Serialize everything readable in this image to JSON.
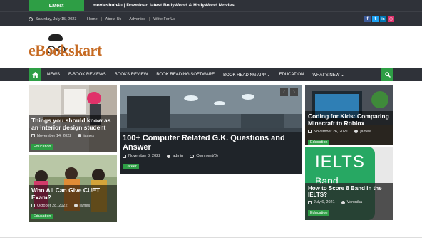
{
  "ticker": {
    "label": "Latest",
    "headline": "movieshub4u | Download latest BollyWood & HollyWood Movies"
  },
  "topbar": {
    "date": "Saturday, July 15, 2023",
    "links": [
      "Home",
      "About Us",
      "Advertise",
      "Write For Us"
    ],
    "social": [
      {
        "icon": "facebook-icon",
        "glyph": "f",
        "color": "#3b5998"
      },
      {
        "icon": "twitter-icon",
        "glyph": "t",
        "color": "#1da1f2"
      },
      {
        "icon": "linkedin-icon",
        "glyph": "in",
        "color": "#0077b5"
      },
      {
        "icon": "instagram-icon",
        "glyph": "◎",
        "color": "#e1306c"
      }
    ]
  },
  "logo": {
    "text": "eBookskart"
  },
  "nav": {
    "items": [
      "NEWS",
      "E-BOOK REVIEWS",
      "BOOKS REVIEW",
      "BOOK READING SOFTWARE",
      "BOOK READING APP ⌄",
      "EDUCATION",
      "WHAT'S NEW ⌄"
    ],
    "home_icon": "home-icon",
    "search_icon": "search-icon"
  },
  "cards": {
    "c1": {
      "title": "Things you should know as an interior design student",
      "date": "November 14, 2022",
      "author": "james",
      "category": "Education"
    },
    "c2": {
      "title": "Who All Can Give CUET Exam?",
      "date": "October 28, 2022",
      "author": "james",
      "category": "Education"
    },
    "main": {
      "title": "100+ Computer Related G.K. Questions and Answer",
      "date": "November 8, 2022",
      "author": "admin",
      "comment": "Comment(0)",
      "category": "Career",
      "prev": "‹",
      "next": "›"
    },
    "c3": {
      "title": "Coding for Kids: Comparing Minecraft to Roblox",
      "date": "November 26, 2021",
      "author": "james",
      "category": "Education"
    },
    "c4": {
      "title": "How to Score 8 Band in the IELTS?",
      "date": "July 6, 2021",
      "author": "Veronika",
      "category": "Education",
      "image_text": "IELTS",
      "image_text2": "Band"
    }
  },
  "colors": {
    "accent": "#2e9e45",
    "dark": "#2f3239",
    "logo": "#c66a22"
  }
}
